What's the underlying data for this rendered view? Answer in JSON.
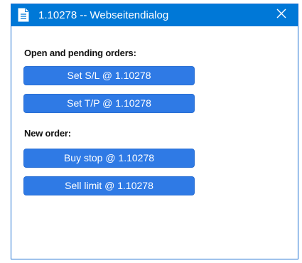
{
  "window": {
    "title": "1.10278 -- Webseitendialog",
    "close_symbol": "✕",
    "title_icon": "document-icon",
    "close_icon": "close-icon",
    "accent_color": "#0078d7",
    "button_color": "#2f7ae5"
  },
  "sections": {
    "open_orders": {
      "heading": "Open and pending orders:",
      "buttons": {
        "set_sl": "Set S/L @ 1.10278",
        "set_tp": "Set T/P @ 1.10278"
      }
    },
    "new_order": {
      "heading": "New order:",
      "buttons": {
        "buy_stop": "Buy stop @ 1.10278",
        "sell_limit": "Sell limit @ 1.10278"
      }
    }
  }
}
